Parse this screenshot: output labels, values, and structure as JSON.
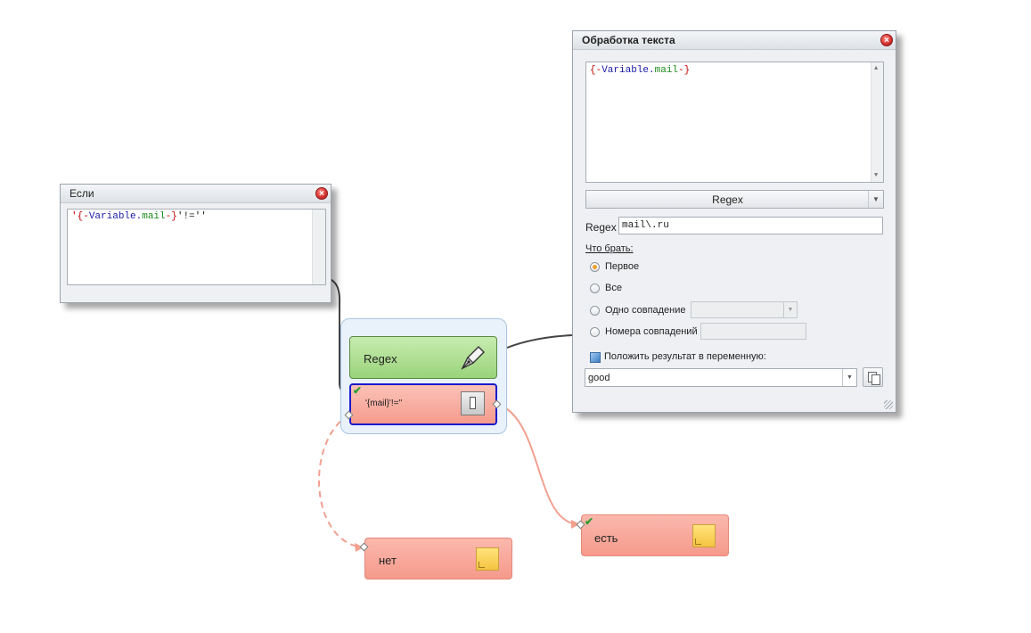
{
  "esli_panel": {
    "title": "Если",
    "close_icon": "close-icon",
    "expression_parts": [
      "'",
      "{-",
      "Variable",
      ".",
      "mail",
      "-}",
      "'!=''"
    ]
  },
  "text_panel": {
    "title": "Обработка текста",
    "close_icon": "close-icon",
    "input_parts": [
      "{-",
      "Variable",
      ".",
      "mail",
      "-}"
    ],
    "mode_select": "Regex",
    "regex_label": "Regex",
    "regex_value": "mail\\.ru",
    "what_take_label": "Что брать:",
    "options": [
      {
        "label": "Первое",
        "selected": true
      },
      {
        "label": "Все",
        "selected": false
      },
      {
        "label": "Одно совпадение",
        "selected": false
      },
      {
        "label": "Номера совпадений",
        "selected": false
      }
    ],
    "put_result_label": "Положить результат в переменную:",
    "result_variable": "good"
  },
  "canvas": {
    "regex_node_label": "Regex",
    "condition_node_label": "'{mail}'!=''",
    "no_node_label": "нет",
    "yes_node_label": "есть"
  },
  "colors": {
    "regex_node": "#a9dc8a",
    "condition_node": "#f7a497",
    "group_fill": "#e9f2fb",
    "selection_border": "#1a1acc",
    "link_line": "#f2a090"
  }
}
